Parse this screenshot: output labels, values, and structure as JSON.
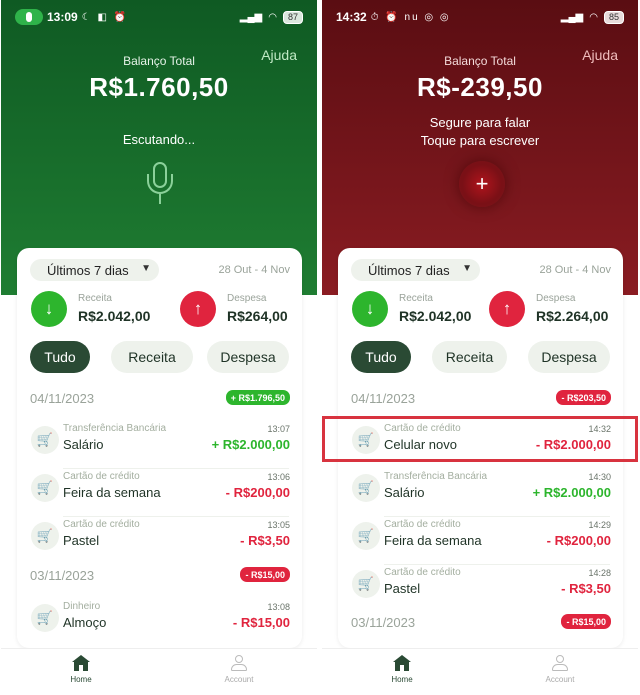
{
  "left": {
    "status": {
      "time": "13:09",
      "icons": "☾ ◧ ⏰",
      "battery": "87"
    },
    "help": "Ajuda",
    "balance_label": "Balanço Total",
    "balance_value": "R$1.760,50",
    "listening": "Escutando...",
    "period": "Últimos 7 dias",
    "range": "28 Out - 4 Nov",
    "income_label": "Receita",
    "income_amount": "R$2.042,00",
    "expense_label": "Despesa",
    "expense_amount": "R$264,00",
    "tabs": [
      "Tudo",
      "Receita",
      "Despesa"
    ],
    "days": [
      {
        "date": "04/11/2023",
        "total": "+ R$1.796,50",
        "kind": "green"
      },
      {
        "date": "03/11/2023",
        "total": "- R$15,00",
        "kind": "red"
      }
    ],
    "transactions": [
      {
        "category": "Transferência Bancária",
        "name": "Salário",
        "time": "13:07",
        "value": "+ R$2.000,00",
        "sign": "pos"
      },
      {
        "category": "Cartão de crédito",
        "name": "Feira da semana",
        "time": "13:06",
        "value": "- R$200,00",
        "sign": "neg"
      },
      {
        "category": "Cartão de crédito",
        "name": "Pastel",
        "time": "13:05",
        "value": "- R$3,50",
        "sign": "neg"
      },
      {
        "category": "Dinheiro",
        "name": "Almoço",
        "time": "13:08",
        "value": "- R$15,00",
        "sign": "neg"
      }
    ],
    "nav": {
      "home": "Home",
      "account": "Account"
    }
  },
  "right": {
    "status": {
      "time": "14:32",
      "icons": "⏱ ⏰ nu ◎ ◎",
      "battery": "85"
    },
    "help": "Ajuda",
    "balance_label": "Balanço Total",
    "balance_value": "R$-239,50",
    "hint_line1": "Segure para falar",
    "hint_line2": "Toque para escrever",
    "plus": "+",
    "period": "Últimos 7 dias",
    "range": "28 Out - 4 Nov",
    "income_label": "Receita",
    "income_amount": "R$2.042,00",
    "expense_label": "Despesa",
    "expense_amount": "R$2.264,00",
    "tabs": [
      "Tudo",
      "Receita",
      "Despesa"
    ],
    "days": [
      {
        "date": "04/11/2023",
        "total": "- R$203,50",
        "kind": "red"
      },
      {
        "date": "03/11/2023",
        "total": "- R$15,00",
        "kind": "red"
      }
    ],
    "transactions": [
      {
        "category": "Cartão de crédito",
        "name": "Celular novo",
        "time": "14:32",
        "value": "- R$2.000,00",
        "sign": "neg"
      },
      {
        "category": "Transferência Bancária",
        "name": "Salário",
        "time": "14:30",
        "value": "+ R$2.000,00",
        "sign": "pos"
      },
      {
        "category": "Cartão de crédito",
        "name": "Feira da semana",
        "time": "14:29",
        "value": "- R$200,00",
        "sign": "neg"
      },
      {
        "category": "Cartão de crédito",
        "name": "Pastel",
        "time": "14:28",
        "value": "- R$3,50",
        "sign": "neg"
      }
    ],
    "nav": {
      "home": "Home",
      "account": "Account"
    }
  },
  "colors": {
    "income": "#2db52d",
    "expense": "#e0243e",
    "green_bg": "#1f7d32",
    "red_bg": "#8a1c22",
    "highlight": "#d8333f"
  }
}
